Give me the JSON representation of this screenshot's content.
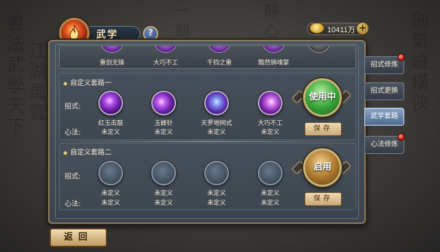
{
  "header": {
    "title": "武学",
    "help_label": "?",
    "currency_amount": "10411万",
    "add_label": "+"
  },
  "top_skills": [
    "重剑无锋",
    "大巧不工",
    "千钧之重",
    "黯然销魂掌"
  ],
  "sets": [
    {
      "title": "自定义套路一",
      "skill_label": "招式:",
      "method_label": "心法:",
      "skills": [
        "红玉击鼓",
        "玉蜂针",
        "天罗地网式",
        "大巧不工"
      ],
      "methods": [
        "未定义",
        "未定义",
        "未定义",
        "未定义"
      ],
      "action_label": "使用中",
      "save_label": "保存"
    },
    {
      "title": "自定义套路二",
      "skill_label": "招式:",
      "method_label": "心法:",
      "skills": [
        "未定义",
        "未定义",
        "未定义",
        "未定义"
      ],
      "methods": [
        "未定义",
        "未定义",
        "未定义",
        "未定义"
      ],
      "action_label": "启用",
      "save_label": "保存"
    }
  ],
  "side_tabs": [
    {
      "label": "招式修炼",
      "active": false,
      "badge": true
    },
    {
      "label": "招式更换",
      "active": false,
      "badge": false
    },
    {
      "label": "武学套路",
      "active": true,
      "badge": false
    },
    {
      "label": "心法修炼",
      "active": false,
      "badge": true
    }
  ],
  "back_label": "返回"
}
